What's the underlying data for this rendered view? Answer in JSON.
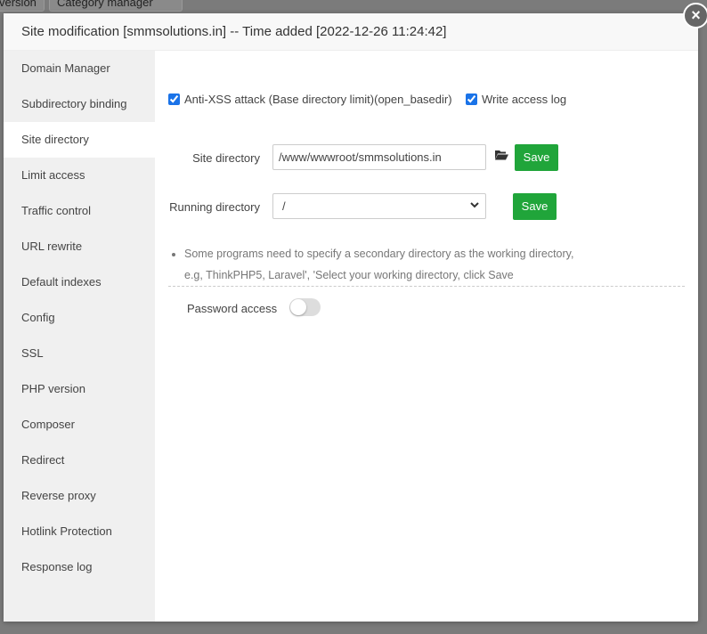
{
  "background": {
    "buttons": [
      "version",
      "Category manager"
    ]
  },
  "dialog": {
    "title": "Site modification [smmsolutions.in] -- Time added [2022-12-26 11:24:42]",
    "close": "×"
  },
  "sidebar": {
    "items": [
      "Domain Manager",
      "Subdirectory binding",
      "Site directory",
      "Limit access",
      "Traffic control",
      "URL rewrite",
      "Default indexes",
      "Config",
      "SSL",
      "PHP version",
      "Composer",
      "Redirect",
      "Reverse proxy",
      "Hotlink Protection",
      "Response log"
    ],
    "active": "Site directory"
  },
  "main": {
    "anti_xss": {
      "label": "Anti-XSS attack (Base directory limit)(open_basedir)",
      "checked": true
    },
    "access_log": {
      "label": "Write access log",
      "checked": true
    },
    "site_dir": {
      "label": "Site directory",
      "value": "/www/wwwroot/smmsolutions.in",
      "save": "Save"
    },
    "running_dir": {
      "label": "Running directory",
      "value": "/",
      "save": "Save"
    },
    "tip": {
      "line1": "Some programs need to specify a secondary directory as the working directory,",
      "line2": "e.g, ThinkPHP5, Laravel', 'Select your working directory, click Save"
    },
    "password_access": {
      "label": "Password access",
      "enabled": false
    }
  }
}
